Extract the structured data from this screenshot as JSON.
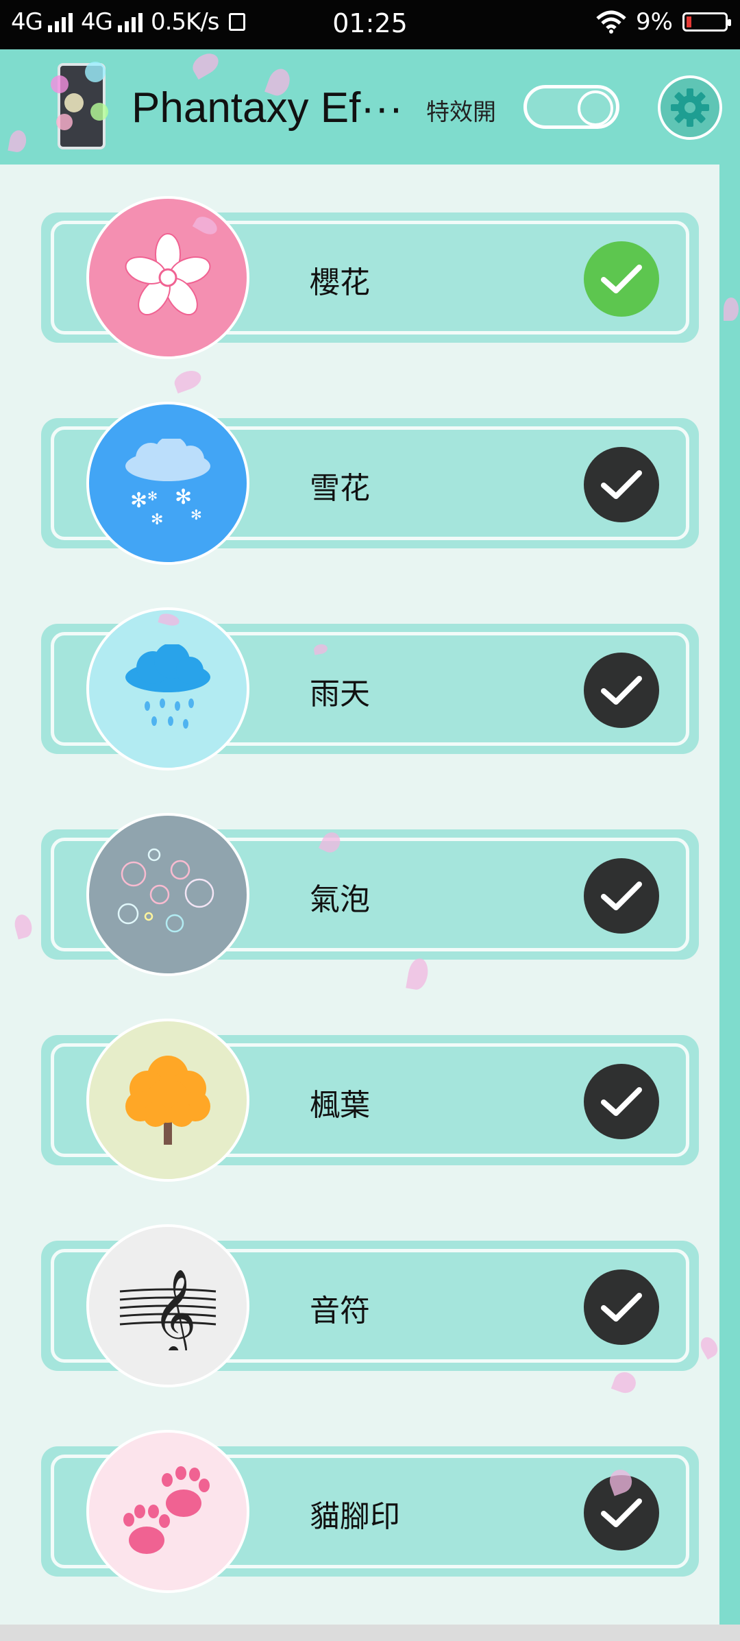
{
  "status_bar": {
    "network_1": "4G",
    "network_2": "4G",
    "speed": "0.5K/s",
    "time": "01:25",
    "battery": "9%",
    "sim_icon": "sim-card-icon",
    "wifi_icon": "wifi-icon"
  },
  "header": {
    "title": "Phantaxy Ef···",
    "effect_label": "特效開",
    "effect_enabled": true,
    "settings_icon": "gear-icon",
    "accent": "#7fdccd"
  },
  "effects": [
    {
      "label": "櫻花",
      "icon": "sakura-icon",
      "bg": "#f48fb1",
      "selected": true
    },
    {
      "label": "雪花",
      "icon": "snow-cloud-icon",
      "bg": "#42a5f5",
      "selected": false
    },
    {
      "label": "雨天",
      "icon": "rain-cloud-icon",
      "bg": "#b2ebf2",
      "selected": false
    },
    {
      "label": "氣泡",
      "icon": "bubbles-icon",
      "bg": "#90a4ae",
      "selected": false
    },
    {
      "label": "楓葉",
      "icon": "tree-icon",
      "bg": "#e6edc9",
      "selected": false
    },
    {
      "label": "音符",
      "icon": "treble-clef-icon",
      "bg": "#eeeeee",
      "selected": false
    },
    {
      "label": "貓腳印",
      "icon": "paw-print-icon",
      "bg": "#fce4ec",
      "selected": false
    }
  ]
}
